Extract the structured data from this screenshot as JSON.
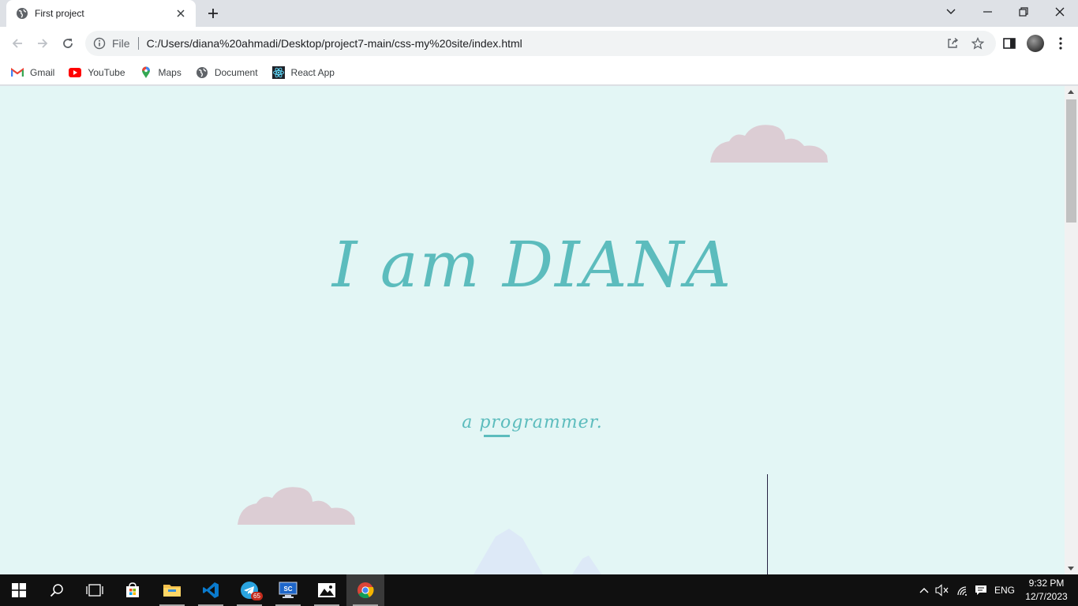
{
  "tab": {
    "title": "First project"
  },
  "toolbar": {
    "scheme": "File",
    "url": "C:/Users/diana%20ahmadi/Desktop/project7-main/css-my%20site/index.html"
  },
  "bookmarks": [
    {
      "label": "Gmail",
      "icon": "gmail-icon"
    },
    {
      "label": "YouTube",
      "icon": "youtube-icon"
    },
    {
      "label": "Maps",
      "icon": "maps-icon"
    },
    {
      "label": "Document",
      "icon": "globe-icon"
    },
    {
      "label": "React App",
      "icon": "react-icon"
    }
  ],
  "page": {
    "title": "I am DIANA",
    "subtitle": "a programmer.",
    "accent_color": "#5cbcbd",
    "background_color": "#e3f6f5",
    "cloud_color": "#dccdd4"
  },
  "taskbar": {
    "telegram_badge": "65",
    "language": "ENG",
    "time": "9:32 PM",
    "date": "12/7/2023"
  }
}
